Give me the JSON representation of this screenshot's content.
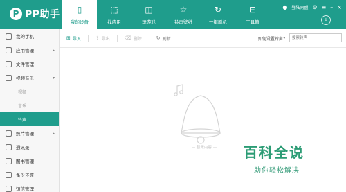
{
  "app": {
    "logo_text": "PP助手",
    "accent": "#1f9d8c"
  },
  "nav": {
    "tabs": [
      {
        "label": "我的设备",
        "icon": "phone-icon",
        "active": true
      },
      {
        "label": "找应用",
        "icon": "bag-icon",
        "active": false
      },
      {
        "label": "玩游戏",
        "icon": "gamepad-icon",
        "active": false
      },
      {
        "label": "铃声壁纸",
        "icon": "star-icon",
        "active": false
      },
      {
        "label": "一键刷机",
        "icon": "refresh-icon",
        "active": false
      },
      {
        "label": "工具箱",
        "icon": "toolbox-icon",
        "active": false
      }
    ],
    "right": {
      "user_label": "登陆同盟"
    }
  },
  "sidebar": {
    "items": [
      {
        "label": "我的手机",
        "icon": "phone-icon"
      },
      {
        "label": "应用管理",
        "icon": "apps-icon",
        "chevron": "▸"
      },
      {
        "label": "文件管理",
        "icon": "folder-icon"
      },
      {
        "label": "视频音乐",
        "icon": "video-icon",
        "chevron": "▾"
      }
    ],
    "sub_items": [
      {
        "label": "视频"
      },
      {
        "label": "音乐"
      },
      {
        "label": "铃声",
        "active": true
      }
    ],
    "items_after": [
      {
        "label": "照片管理",
        "icon": "photo-icon",
        "chevron": "▸"
      },
      {
        "label": "通讯录",
        "icon": "contacts-icon"
      },
      {
        "label": "图书管理",
        "icon": "book-icon"
      },
      {
        "label": "备份还原",
        "icon": "backup-icon"
      },
      {
        "label": "短信管理",
        "icon": "sms-icon"
      }
    ]
  },
  "toolbar": {
    "import_label": "导入",
    "export_label": "导出",
    "delete_label": "删除",
    "refresh_label": "刷新",
    "help_link": "如何设置铃声?",
    "search_placeholder": "搜索铃声"
  },
  "empty_state": {
    "text": "— 暂无内容 —"
  },
  "watermark": {
    "main": "百科全说",
    "sub": "助你轻松解决"
  }
}
